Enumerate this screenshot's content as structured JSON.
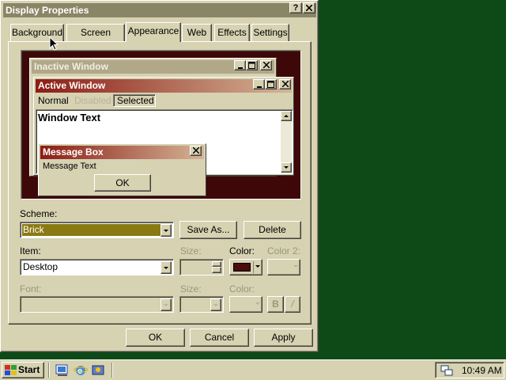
{
  "window": {
    "title": "Display Properties",
    "help_label": "?",
    "close_label": "✕"
  },
  "tabs": [
    {
      "label": "Background",
      "active": false
    },
    {
      "label": "Screen Saver",
      "active": false
    },
    {
      "label": "Appearance",
      "active": true
    },
    {
      "label": "Web",
      "active": false
    },
    {
      "label": "Effects",
      "active": false
    },
    {
      "label": "Settings",
      "active": false
    }
  ],
  "preview": {
    "inactive_title": "Inactive Window",
    "active_title": "Active Window",
    "menu": {
      "normal": "Normal",
      "disabled": "Disabled",
      "selected": "Selected"
    },
    "window_text": "Window Text",
    "message_box_title": "Message Box",
    "message_text": "Message Text",
    "ok_label": "OK"
  },
  "form": {
    "scheme_label": "Scheme:",
    "scheme_value": "Brick",
    "save_as_label": "Save As...",
    "delete_label": "Delete",
    "item_label": "Item:",
    "item_value": "Desktop",
    "size_label": "Size:",
    "color_label": "Color:",
    "color2_label": "Color 2:",
    "font_label": "Font:",
    "font_size_label": "Size:",
    "font_color_label": "Color:",
    "bold_label": "B",
    "italic_label": "/",
    "color_swatch": "#4a0c0c"
  },
  "buttons": {
    "ok": "OK",
    "cancel": "Cancel",
    "apply": "Apply"
  },
  "taskbar": {
    "start_label": "Start",
    "clock": "10:49 AM"
  },
  "colors": {
    "desktop": "#0e4a17",
    "active_title_start": "#8c1c14",
    "active_title_end": "#d4b496",
    "inactive_title": "#b0a888",
    "scheme_highlight": "#8a7a14"
  }
}
